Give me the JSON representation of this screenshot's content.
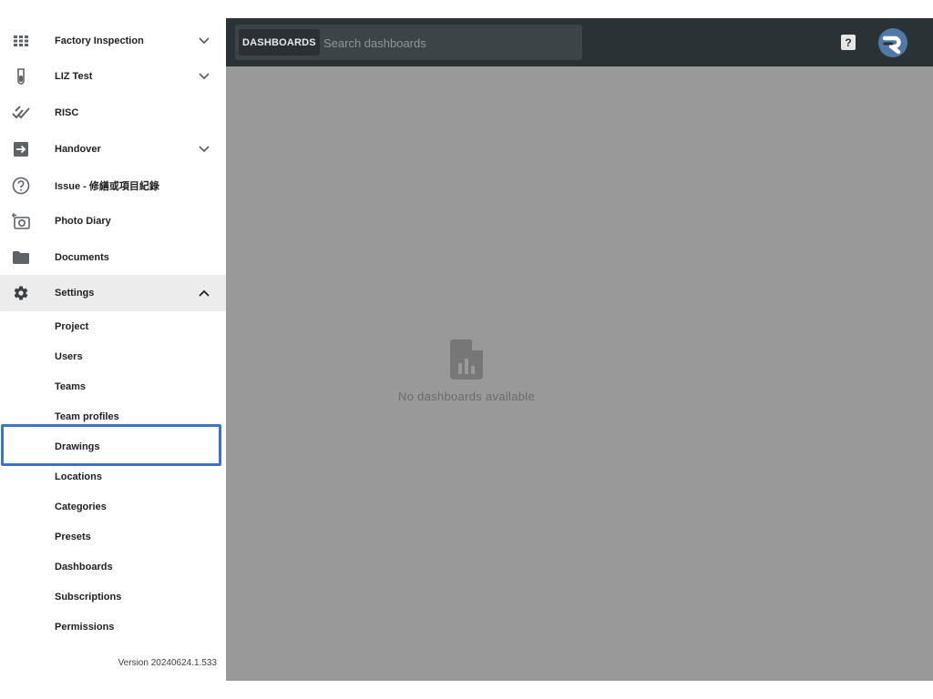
{
  "sidebar": {
    "items": [
      {
        "label": "Factory Inspection",
        "icon": "grid-icon",
        "chevron": "down"
      },
      {
        "label": "LIZ Test",
        "icon": "test-tube-icon",
        "chevron": "down"
      },
      {
        "label": "RISC",
        "icon": "double-check-icon"
      },
      {
        "label": "Handover",
        "icon": "arrow-right-box-icon",
        "chevron": "down"
      },
      {
        "label": "Issue - 修繕或項目紀錄",
        "icon": "question-circle-icon"
      },
      {
        "label": "Photo Diary",
        "icon": "add-camera-icon"
      },
      {
        "label": "Documents",
        "icon": "folder-icon"
      },
      {
        "label": "Settings",
        "icon": "gear-icon",
        "chevron": "up",
        "active": true
      }
    ],
    "settings_sub": [
      "Project",
      "Users",
      "Teams",
      "Team profiles",
      "Drawings",
      "Locations",
      "Categories",
      "Presets",
      "Dashboards",
      "Subscriptions",
      "Permissions"
    ],
    "highlighted_item": "Drawings",
    "version": "Version 20240624.1.533"
  },
  "topbar": {
    "search_chip": "DASHBOARDS",
    "search_placeholder": "Search dashboards"
  },
  "main": {
    "empty_text": "No dashboards available"
  },
  "colors": {
    "topbar": "#2b3235",
    "overlay": "#999999",
    "highlight": "#3b72d6",
    "avatar": "#5079a8"
  }
}
